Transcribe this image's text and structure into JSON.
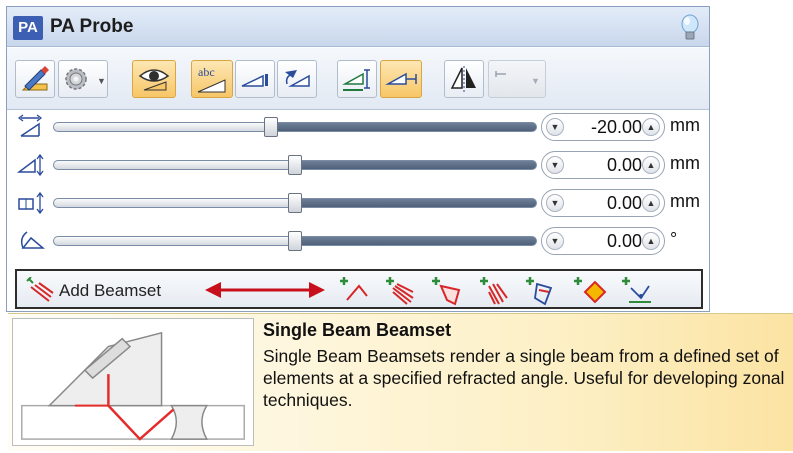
{
  "window": {
    "badge": "PA",
    "title": "PA Probe"
  },
  "toolbar": {
    "buttons": [
      {
        "icon": "ruler-pencil-icon",
        "state": "plain"
      },
      {
        "icon": "gear-icon",
        "state": "plain",
        "dropdown": true
      },
      {
        "icon": "eye-icon",
        "state": "on"
      },
      {
        "icon": "abc-label-icon",
        "state": "on",
        "text": "abc"
      },
      {
        "icon": "wedge-icon",
        "state": "plain"
      },
      {
        "icon": "rotate-probe-icon",
        "state": "plain"
      },
      {
        "icon": "index-offset-icon",
        "state": "plain"
      },
      {
        "icon": "skew-offset-icon",
        "state": "on"
      },
      {
        "icon": "mirror-icon",
        "state": "plain"
      },
      {
        "icon": "disabled-option-icon",
        "state": "disabled",
        "dropdown": true
      }
    ]
  },
  "sliders": [
    {
      "icon": "index-offset-icon",
      "value": "-20.00",
      "unit": "mm",
      "position": 0.45
    },
    {
      "icon": "scan-offset-icon",
      "value": "0.00",
      "unit": "mm",
      "position": 0.5
    },
    {
      "icon": "height-offset-icon",
      "value": "0.00",
      "unit": "mm",
      "position": 0.5
    },
    {
      "icon": "skew-angle-icon",
      "value": "0.00",
      "unit": "°",
      "position": 0.5
    }
  ],
  "beamset_bar": {
    "label": "Add Beamset",
    "arrow_color": "#c8101c",
    "icons": [
      "add-single-beam-icon",
      "add-sectorial-beamset-icon",
      "add-focused-beamset-icon",
      "add-linear-beamset-icon",
      "add-compound-beamset-icon",
      "add-zonal-beamset-icon",
      "add-tfm-beamset-icon"
    ]
  },
  "tooltip": {
    "title": "Single Beam Beamset",
    "body": "Single Beam Beamsets render a single beam from a defined set of elements at a specified refracted angle. Useful for developing zonal techniques."
  },
  "colors": {
    "accent_orange": "#f7c667",
    "beam_red": "#e52b2b",
    "title_blue": "#3c5fb4"
  }
}
